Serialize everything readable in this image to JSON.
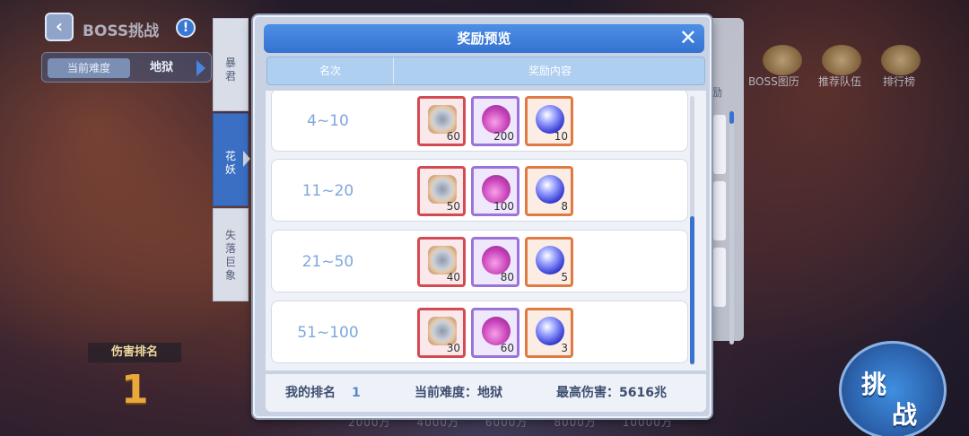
{
  "header": {
    "back_icon": "chevron-left-icon",
    "title": "BOSS挑战",
    "help_icon": "help-icon",
    "difficulty_label": "当前难度",
    "difficulty_value": "地狱"
  },
  "boss_tabs": [
    {
      "label": "暴君",
      "active": false
    },
    {
      "label": "花妖",
      "active": true
    },
    {
      "label": "失落巨象",
      "active": false
    }
  ],
  "right_menu": [
    {
      "label": "BOSS图历",
      "icon": "book-icon"
    },
    {
      "label": "推荐队伍",
      "icon": "team-icon"
    },
    {
      "label": "排行榜",
      "icon": "trophy-icon"
    }
  ],
  "behind_panel_text": "励",
  "damage_rank": {
    "label": "伤害排名",
    "value": "1"
  },
  "damage_scale": [
    "2000万",
    "4000万",
    "6000万",
    "8000万",
    "10000万"
  ],
  "challenge_button": {
    "line1": "挑",
    "line2": "战"
  },
  "modal": {
    "title": "奖励预览",
    "close_icon": "close-icon",
    "columns": [
      "名次",
      "奖励内容"
    ],
    "rows": [
      {
        "range": "4~10",
        "items": [
          {
            "type": "gear",
            "count": "60"
          },
          {
            "type": "potion",
            "count": "200"
          },
          {
            "type": "orb",
            "count": "10"
          }
        ]
      },
      {
        "range": "11~20",
        "items": [
          {
            "type": "gear",
            "count": "50"
          },
          {
            "type": "potion",
            "count": "100"
          },
          {
            "type": "orb",
            "count": "8"
          }
        ]
      },
      {
        "range": "21~50",
        "items": [
          {
            "type": "gear",
            "count": "40"
          },
          {
            "type": "potion",
            "count": "80"
          },
          {
            "type": "orb",
            "count": "5"
          }
        ]
      },
      {
        "range": "51~100",
        "items": [
          {
            "type": "gear",
            "count": "30"
          },
          {
            "type": "potion",
            "count": "60"
          },
          {
            "type": "orb",
            "count": "3"
          }
        ]
      }
    ],
    "footer": {
      "my_rank_label": "我的排名",
      "my_rank_value": "1",
      "difficulty_text": "当前难度：地狱",
      "max_damage_text": "最高伤害：5616兆"
    }
  },
  "colors": {
    "accent_blue": "#3a72d1",
    "header_blue": "#4d8fe6",
    "rank_text": "#7ea7dd",
    "rarity_red": "#d44a52",
    "rarity_purple": "#9a74d6",
    "rarity_orange": "#e07a42"
  }
}
